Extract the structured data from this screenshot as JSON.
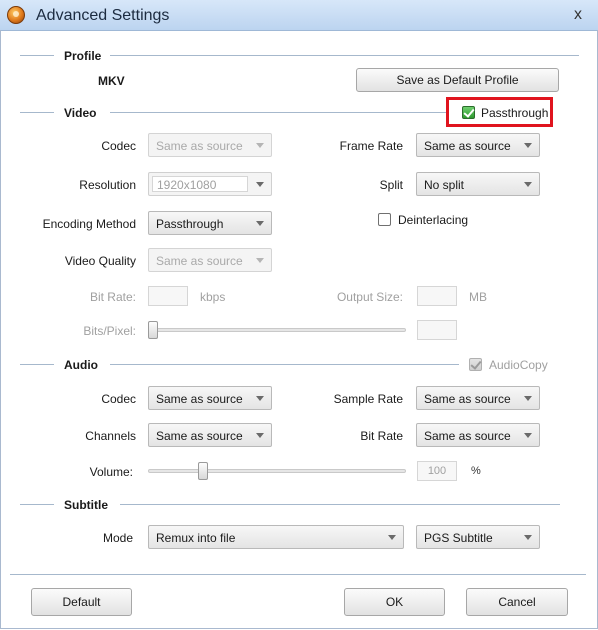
{
  "window": {
    "title": "Advanced Settings",
    "close_glyph": "x"
  },
  "profile": {
    "header": "Profile",
    "format": "MKV",
    "save_default_label": "Save as Default Profile"
  },
  "video": {
    "header": "Video",
    "passthrough_label": "Passthrough",
    "passthrough_checked": true,
    "codec_label": "Codec",
    "codec_value": "Same as source",
    "frame_rate_label": "Frame Rate",
    "frame_rate_value": "Same as source",
    "resolution_label": "Resolution",
    "resolution_value": "1920x1080",
    "split_label": "Split",
    "split_value": "No split",
    "encoding_method_label": "Encoding Method",
    "encoding_method_value": "Passthrough",
    "deinterlacing_label": "Deinterlacing",
    "deinterlacing_checked": false,
    "video_quality_label": "Video Quality",
    "video_quality_value": "Same as source",
    "bit_rate_label": "Bit Rate:",
    "bit_rate_value": "",
    "bit_rate_unit": "kbps",
    "output_size_label": "Output Size:",
    "output_size_value": "",
    "output_size_unit": "MB",
    "bits_pixel_label": "Bits/Pixel:",
    "bits_pixel_value": "",
    "bits_pixel_slider_level": 0.0
  },
  "audio": {
    "header": "Audio",
    "audiocopy_label": "AudioCopy",
    "audiocopy_checked": true,
    "codec_label": "Codec",
    "codec_value": "Same as source",
    "sample_rate_label": "Sample Rate",
    "sample_rate_value": "Same as source",
    "channels_label": "Channels",
    "channels_value": "Same as source",
    "bit_rate_label": "Bit Rate",
    "bit_rate_value": "Same as source",
    "volume_label": "Volume:",
    "volume_value": "100",
    "volume_unit": "%",
    "volume_slider_level": 0.2
  },
  "subtitle": {
    "header": "Subtitle",
    "mode_label": "Mode",
    "mode_value": "Remux into file",
    "format_value": "PGS Subtitle"
  },
  "buttons": {
    "default_label": "Default",
    "ok_label": "OK",
    "cancel_label": "Cancel"
  },
  "colors": {
    "highlight": "#e0141e",
    "title_bar": "#c9ddf4",
    "check_green": "#2e9a2e"
  }
}
